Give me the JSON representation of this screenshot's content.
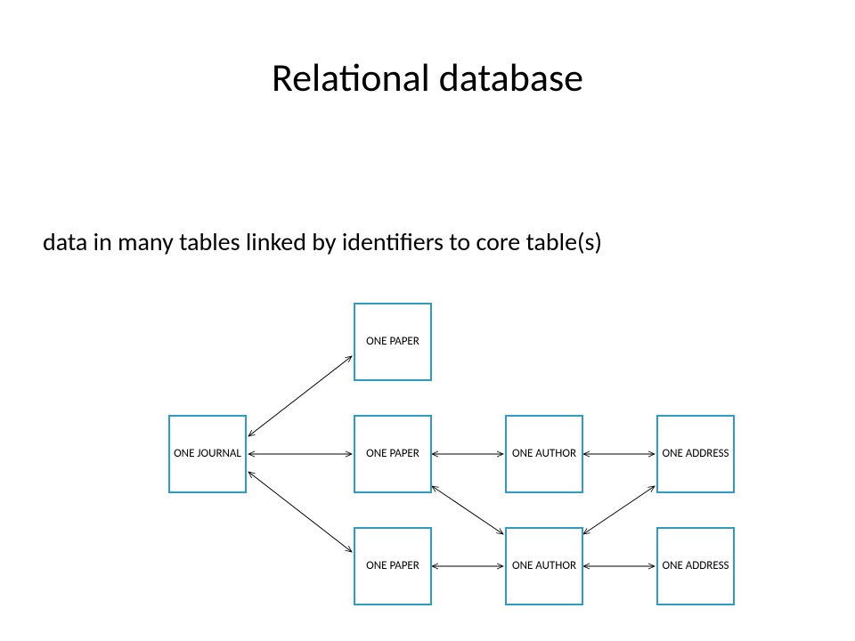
{
  "title": "Relational database",
  "subtitle": "data in many tables linked by identifiers to core table(s)",
  "boxes": {
    "journal": "ONE JOURNAL",
    "paper1": "ONE PAPER",
    "paper2": "ONE PAPER",
    "paper3": "ONE PAPER",
    "author1": "ONE AUTHOR",
    "author2": "ONE AUTHOR",
    "address1": "ONE ADDRESS",
    "address2": "ONE ADDRESS"
  }
}
